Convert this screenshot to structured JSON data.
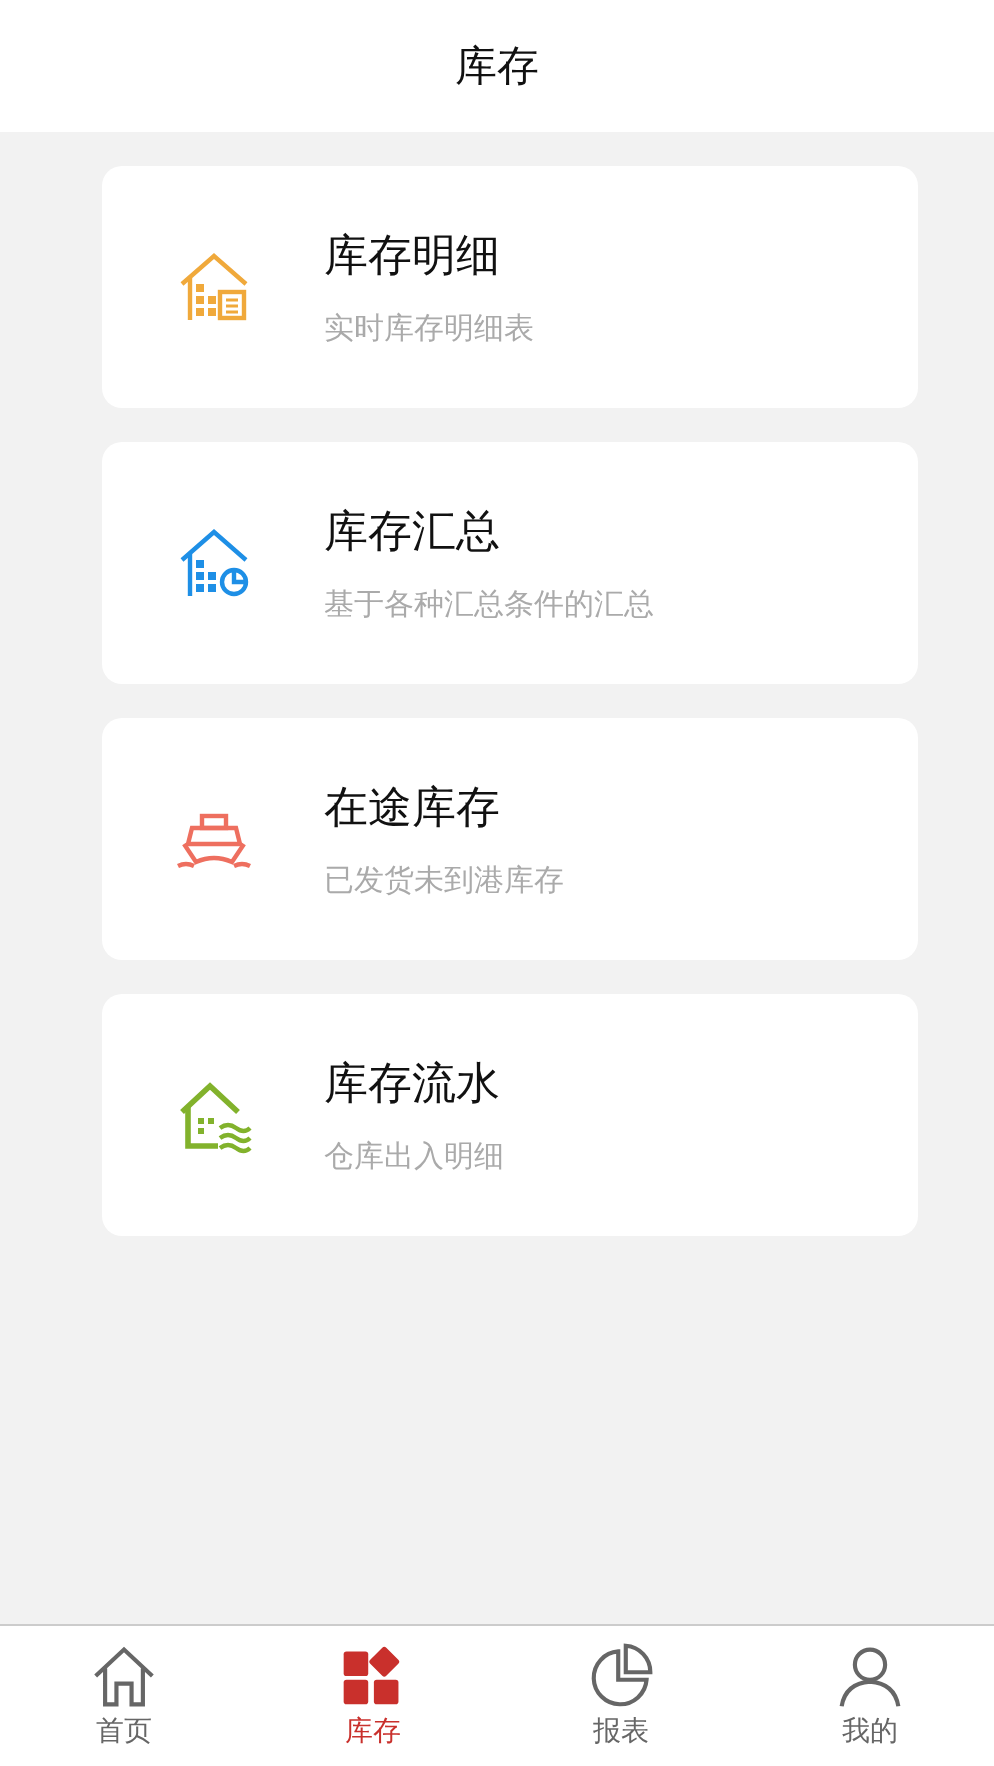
{
  "header": {
    "title": "库存"
  },
  "cards": [
    {
      "kind": "warehouse-list",
      "color": "#f0a93b",
      "title": "库存明细",
      "subtitle": "实时库存明细表"
    },
    {
      "kind": "warehouse-chart",
      "color": "#1e8fe6",
      "title": "库存汇总",
      "subtitle": "基于各种汇总条件的汇总"
    },
    {
      "kind": "ship",
      "color": "#ee6f5f",
      "title": "在途库存",
      "subtitle": "已发货未到港库存"
    },
    {
      "kind": "warehouse-water",
      "color": "#82b22c",
      "title": "库存流水",
      "subtitle": "仓库出入明细"
    }
  ],
  "tabs": [
    {
      "kind": "home",
      "label": "首页",
      "selected": false
    },
    {
      "kind": "grid",
      "label": "库存",
      "selected": true
    },
    {
      "kind": "pie",
      "label": "报表",
      "selected": false
    },
    {
      "kind": "person",
      "label": "我的",
      "selected": false
    }
  ]
}
